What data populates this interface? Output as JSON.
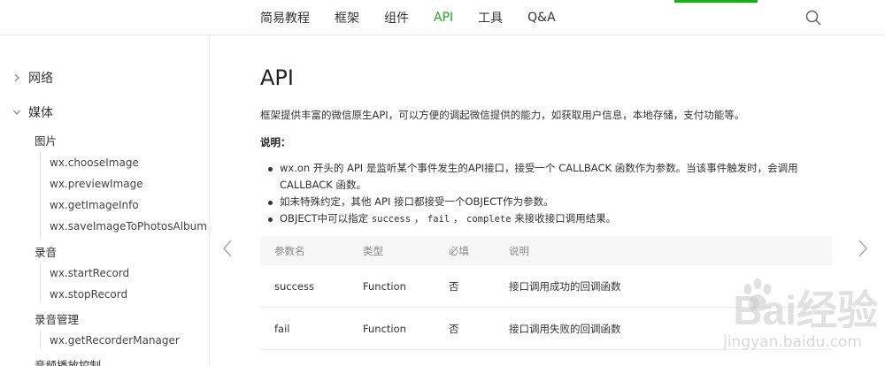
{
  "nav": {
    "items": [
      {
        "label": "简易教程",
        "active": false
      },
      {
        "label": "框架",
        "active": false
      },
      {
        "label": "组件",
        "active": false
      },
      {
        "label": "API",
        "active": true
      },
      {
        "label": "工具",
        "active": false
      },
      {
        "label": "Q&A",
        "active": false
      }
    ],
    "accent_color": "#1aad19",
    "search_icon": "search-icon"
  },
  "sidebar": {
    "groups": [
      {
        "label": "网络",
        "expanded": false
      },
      {
        "label": "媒体",
        "expanded": true
      }
    ],
    "categories": [
      {
        "label": "图片",
        "items": [
          "wx.chooseImage",
          "wx.previewImage",
          "wx.getImageInfo",
          "wx.saveImageToPhotosAlbum"
        ]
      },
      {
        "label": "录音",
        "items": [
          "wx.startRecord",
          "wx.stopRecord"
        ]
      },
      {
        "label": "录音管理",
        "items": [
          "wx.getRecorderManager"
        ]
      },
      {
        "label": "音频播放控制",
        "items": []
      }
    ]
  },
  "main": {
    "title": "API",
    "intro": "框架提供丰富的微信原生API，可以方便的调起微信提供的能力，如获取用户信息，本地存储，支付功能等。",
    "note_title": "说明：",
    "bullets": {
      "b1_line1": "wx.on 开头的 API 是监听某个事件发生的API接口，接受一个 CALLBACK 函数作为参数。当该事件触发时，会调用",
      "b1_line2": "CALLBACK 函数。",
      "b2": "如未特殊约定，其他 API 接口都接受一个OBJECT作为参数。",
      "b3_prefix": "OBJECT中可以指定",
      "b3_code1": "success",
      "b3_sep1": "，",
      "b3_code2": "fail",
      "b3_sep2": "，",
      "b3_code3": "complete",
      "b3_suffix": "来接收接口调用结果。"
    },
    "table": {
      "headers": [
        "参数名",
        "类型",
        "必填",
        "说明"
      ],
      "rows": [
        [
          "success",
          "Function",
          "否",
          "接口调用成功的回调函数"
        ],
        [
          "fail",
          "Function",
          "否",
          "接口调用失败的回调函数"
        ]
      ]
    }
  },
  "watermark": {
    "main": "Bai经验",
    "sub": "jingyan.baidu.com"
  }
}
